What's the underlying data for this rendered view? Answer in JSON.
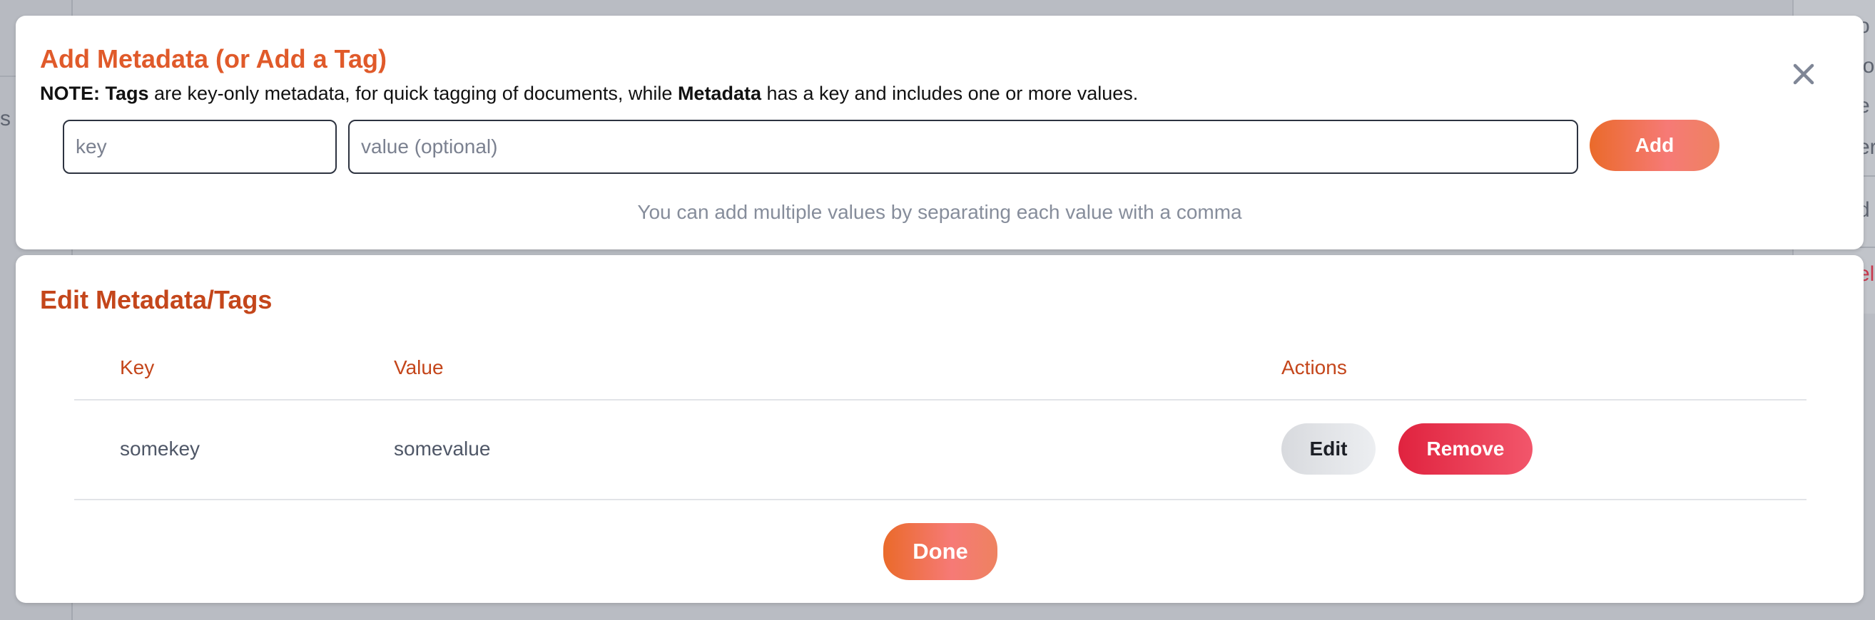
{
  "background": {
    "left_fragment": "s",
    "right_fragments": [
      "o",
      "lo",
      "e",
      "er",
      "d",
      "el"
    ]
  },
  "add_modal": {
    "title": "Add Metadata (or Add a Tag)",
    "note": {
      "prefix": "NOTE:",
      "tags_word": "Tags",
      "middle": " are key-only metadata, for quick tagging of documents, while ",
      "metadata_word": "Metadata",
      "suffix": " has a key and includes one or more values."
    },
    "key_placeholder": "key",
    "value_placeholder": "value (optional)",
    "add_label": "Add",
    "hint": "You can add multiple values by separating each value with a comma",
    "close_icon": "close-icon"
  },
  "edit_modal": {
    "title": "Edit Metadata/Tags",
    "columns": {
      "key": "Key",
      "value": "Value",
      "actions": "Actions"
    },
    "rows": [
      {
        "key": "somekey",
        "value": "somevalue",
        "edit_label": "Edit",
        "remove_label": "Remove"
      }
    ],
    "done_label": "Done"
  },
  "colors": {
    "title_orange": "#e05a2a",
    "header_orange": "#c4461b",
    "remove_red": "#e0233f",
    "overlay": "#b9bcc3"
  }
}
